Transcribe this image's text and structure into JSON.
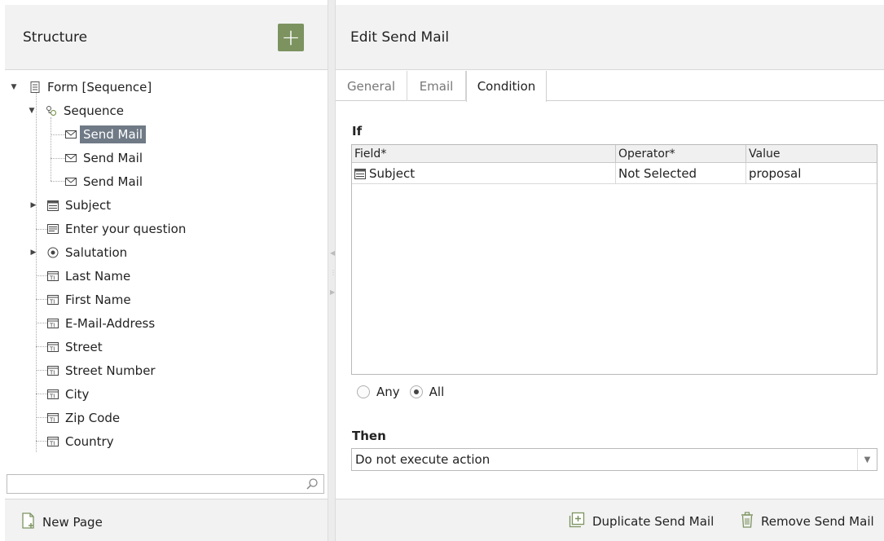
{
  "structure": {
    "title": "Structure",
    "add_label": "+",
    "tree": [
      {
        "label": "Form [Sequence]",
        "icon": "form-icon"
      },
      {
        "label": "Sequence",
        "icon": "sequence-icon"
      },
      {
        "label": "Send Mail",
        "icon": "mail-icon",
        "selected": true
      },
      {
        "label": "Send Mail",
        "icon": "mail-icon"
      },
      {
        "label": "Send Mail",
        "icon": "mail-icon"
      },
      {
        "label": "Subject",
        "icon": "list-field-icon"
      },
      {
        "label": "Enter your question",
        "icon": "textarea-field-icon"
      },
      {
        "label": "Salutation",
        "icon": "radio-field-icon"
      },
      {
        "label": "Last Name",
        "icon": "text-field-icon"
      },
      {
        "label": "First Name",
        "icon": "text-field-icon"
      },
      {
        "label": "E-Mail-Address",
        "icon": "text-field-icon"
      },
      {
        "label": "Street",
        "icon": "text-field-icon"
      },
      {
        "label": "Street Number",
        "icon": "text-field-icon"
      },
      {
        "label": "City",
        "icon": "text-field-icon"
      },
      {
        "label": "Zip Code",
        "icon": "text-field-icon"
      },
      {
        "label": "Country",
        "icon": "text-field-icon"
      }
    ],
    "search_placeholder": "",
    "new_page_label": "New Page"
  },
  "editor": {
    "title": "Edit Send Mail",
    "tabs": [
      {
        "label": "General",
        "active": false
      },
      {
        "label": "Email",
        "active": false
      },
      {
        "label": "Condition",
        "active": true
      }
    ],
    "if_label": "If",
    "columns": [
      "Field*",
      "Operator*",
      "Value"
    ],
    "rows": [
      {
        "field": "Subject",
        "operator": "Not Selected",
        "value": "proposal"
      }
    ],
    "match_options": [
      {
        "label": "Any",
        "checked": false
      },
      {
        "label": "All",
        "checked": true
      }
    ],
    "then_label": "Then",
    "then_value": "Do not execute action",
    "duplicate_label": "Duplicate Send Mail",
    "remove_label": "Remove Send Mail"
  },
  "colors": {
    "accent_green": "#7c9360",
    "selection": "#6f7a86",
    "panel_bg": "#f2f2f2"
  }
}
